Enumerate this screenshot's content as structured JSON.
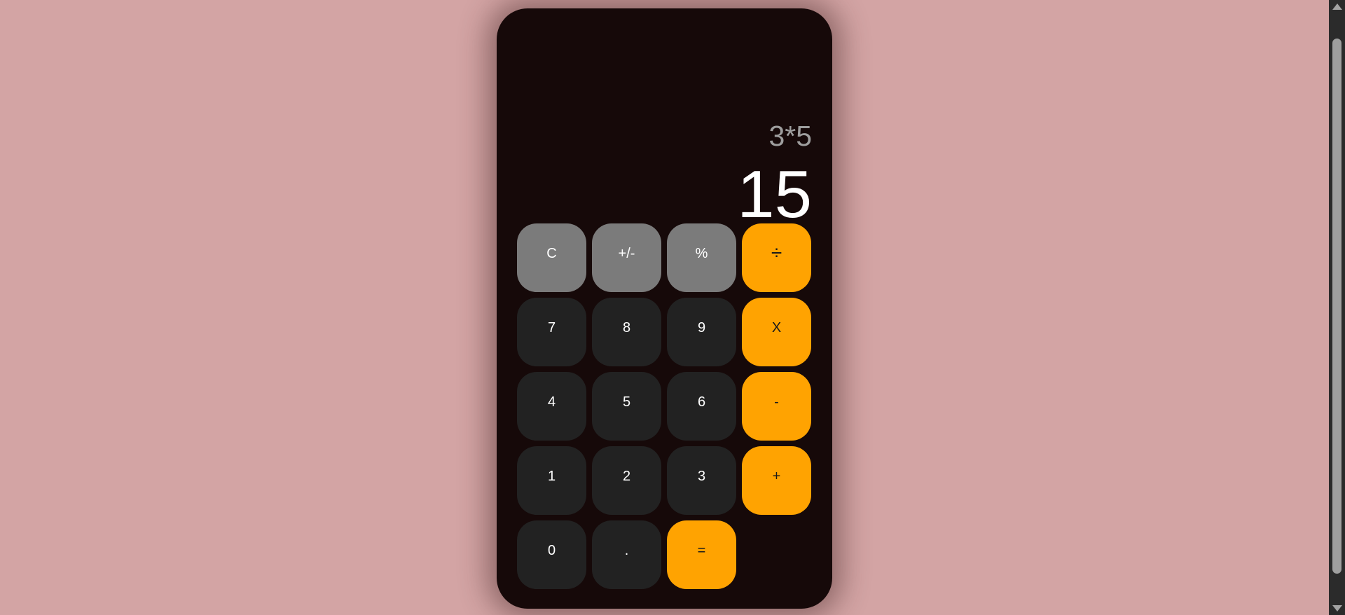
{
  "display": {
    "expression": "3*5",
    "result": "15"
  },
  "keys": {
    "clear": "C",
    "negate": "+/-",
    "percent": "%",
    "divide": "÷",
    "seven": "7",
    "eight": "8",
    "nine": "9",
    "multiply": "X",
    "four": "4",
    "five": "5",
    "six": "6",
    "subtract": "-",
    "one": "1",
    "two": "2",
    "three": "3",
    "add": "+",
    "zero": "0",
    "decimal": ".",
    "equals": "="
  },
  "colors": {
    "page_background": "#d3a4a4",
    "calculator_background": "#160909",
    "function_key": "#7b7b7b",
    "number_key": "#222222",
    "operator_key": "#ffa301"
  }
}
